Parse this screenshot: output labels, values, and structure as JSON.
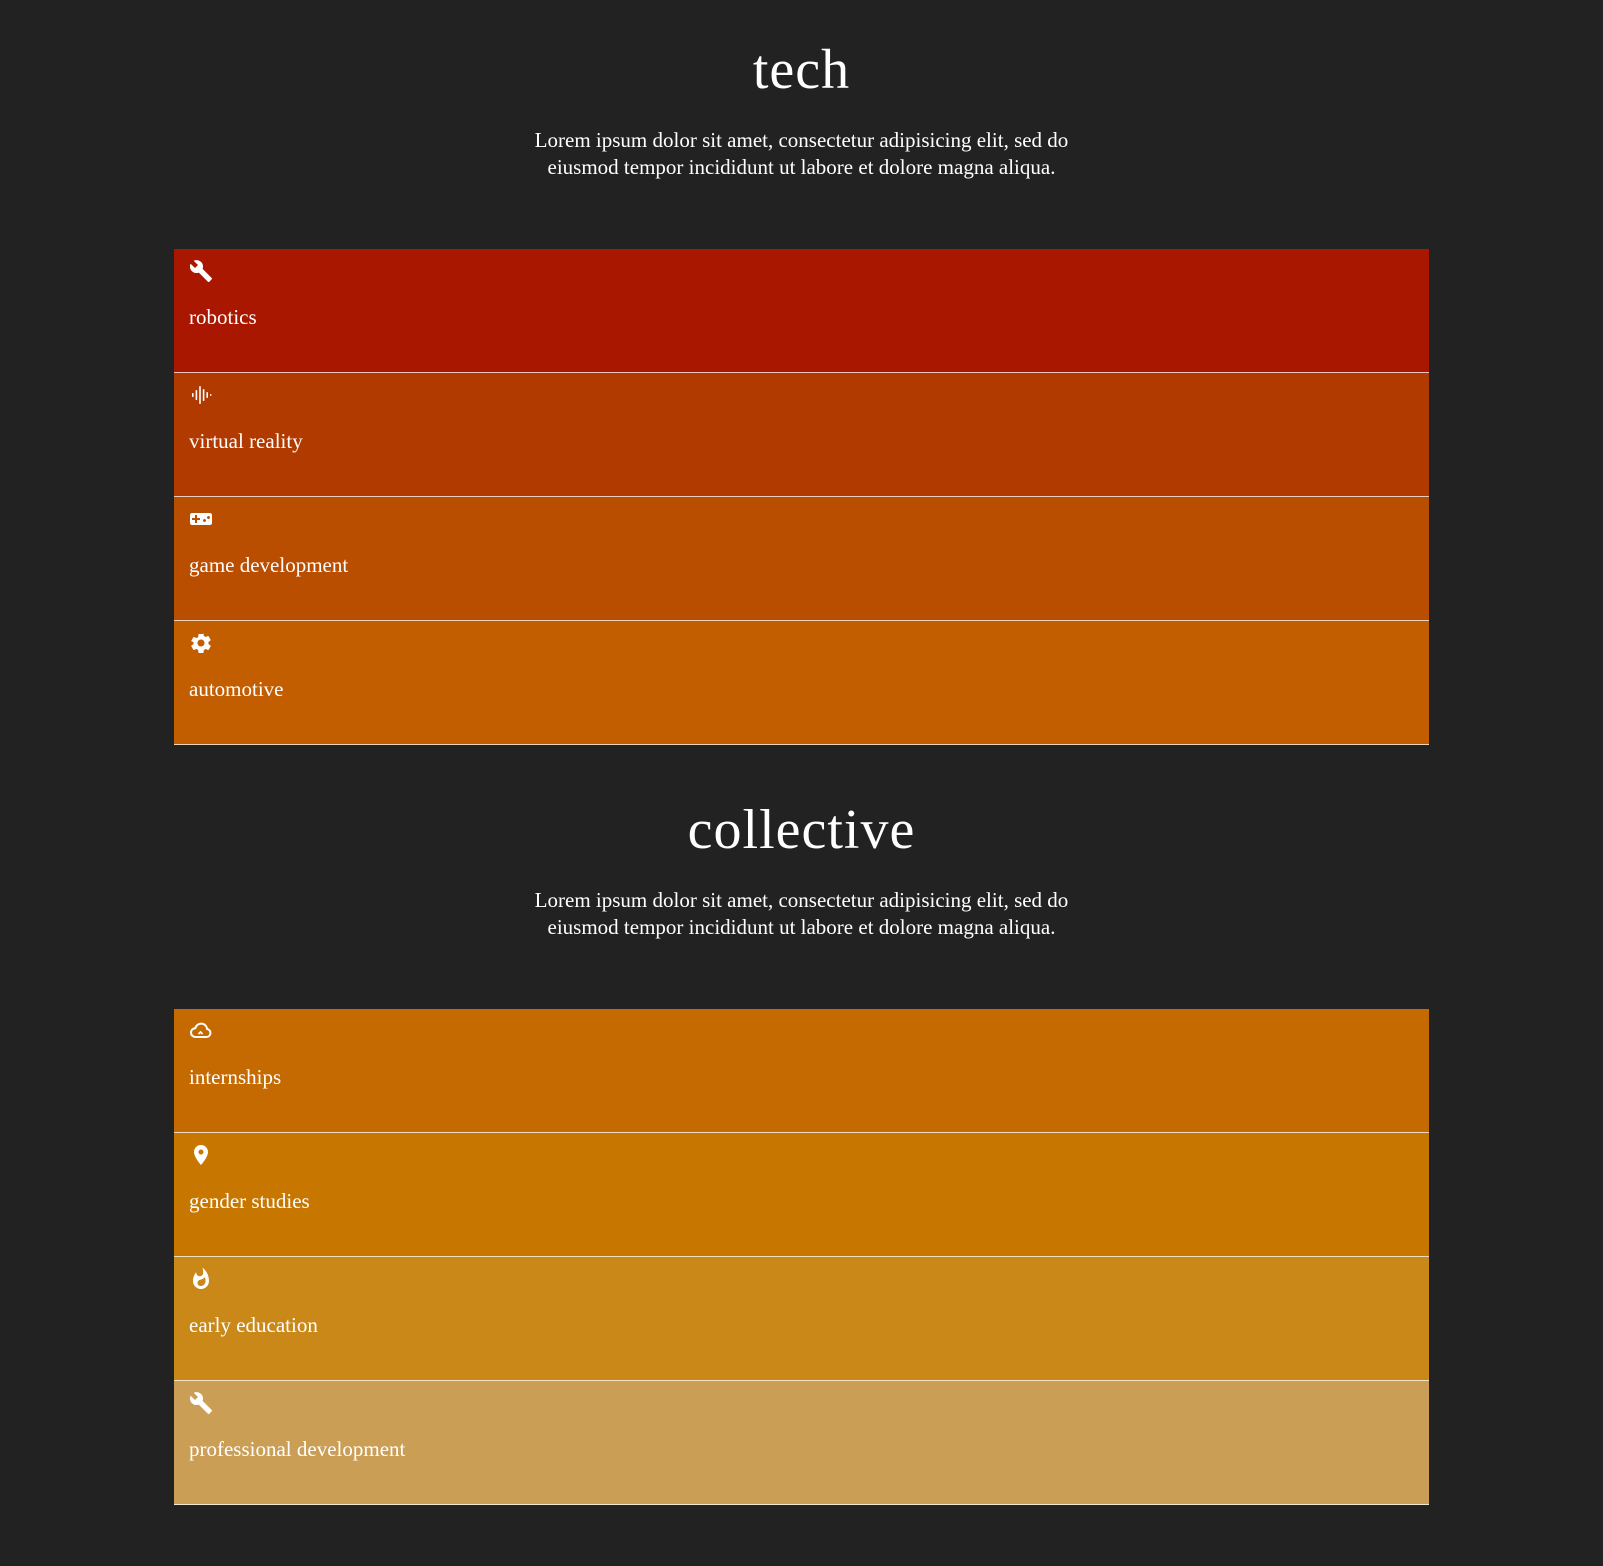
{
  "sections": [
    {
      "title": "tech",
      "description": "Lorem ipsum dolor sit amet, consectetur adipisicing elit, sed do eiusmod tempor incididunt ut labore et dolore magna aliqua.",
      "items": [
        {
          "label": "robotics",
          "icon": "wrench-icon",
          "color": "#AA1700"
        },
        {
          "label": "virtual reality",
          "icon": "audio-wave-icon",
          "color": "#B13A00"
        },
        {
          "label": "game development",
          "icon": "gamepad-icon",
          "color": "#BA4E00"
        },
        {
          "label": "automotive",
          "icon": "gear-icon",
          "color": "#C25E00"
        }
      ]
    },
    {
      "title": "collective",
      "description": "Lorem ipsum dolor sit amet, consectetur adipisicing elit, sed do eiusmod tempor incididunt ut labore et dolore magna aliqua.",
      "items": [
        {
          "label": "internships",
          "icon": "cloud-icon",
          "color": "#C46A00"
        },
        {
          "label": "gender studies",
          "icon": "map-pin-icon",
          "color": "#C77700"
        },
        {
          "label": "early education",
          "icon": "flame-icon",
          "color": "#C98818"
        },
        {
          "label": "professional development",
          "icon": "wrench-icon",
          "color": "#CB9E55"
        }
      ]
    }
  ],
  "colors": {
    "background": "#222222",
    "text": "#FFFFFF"
  }
}
